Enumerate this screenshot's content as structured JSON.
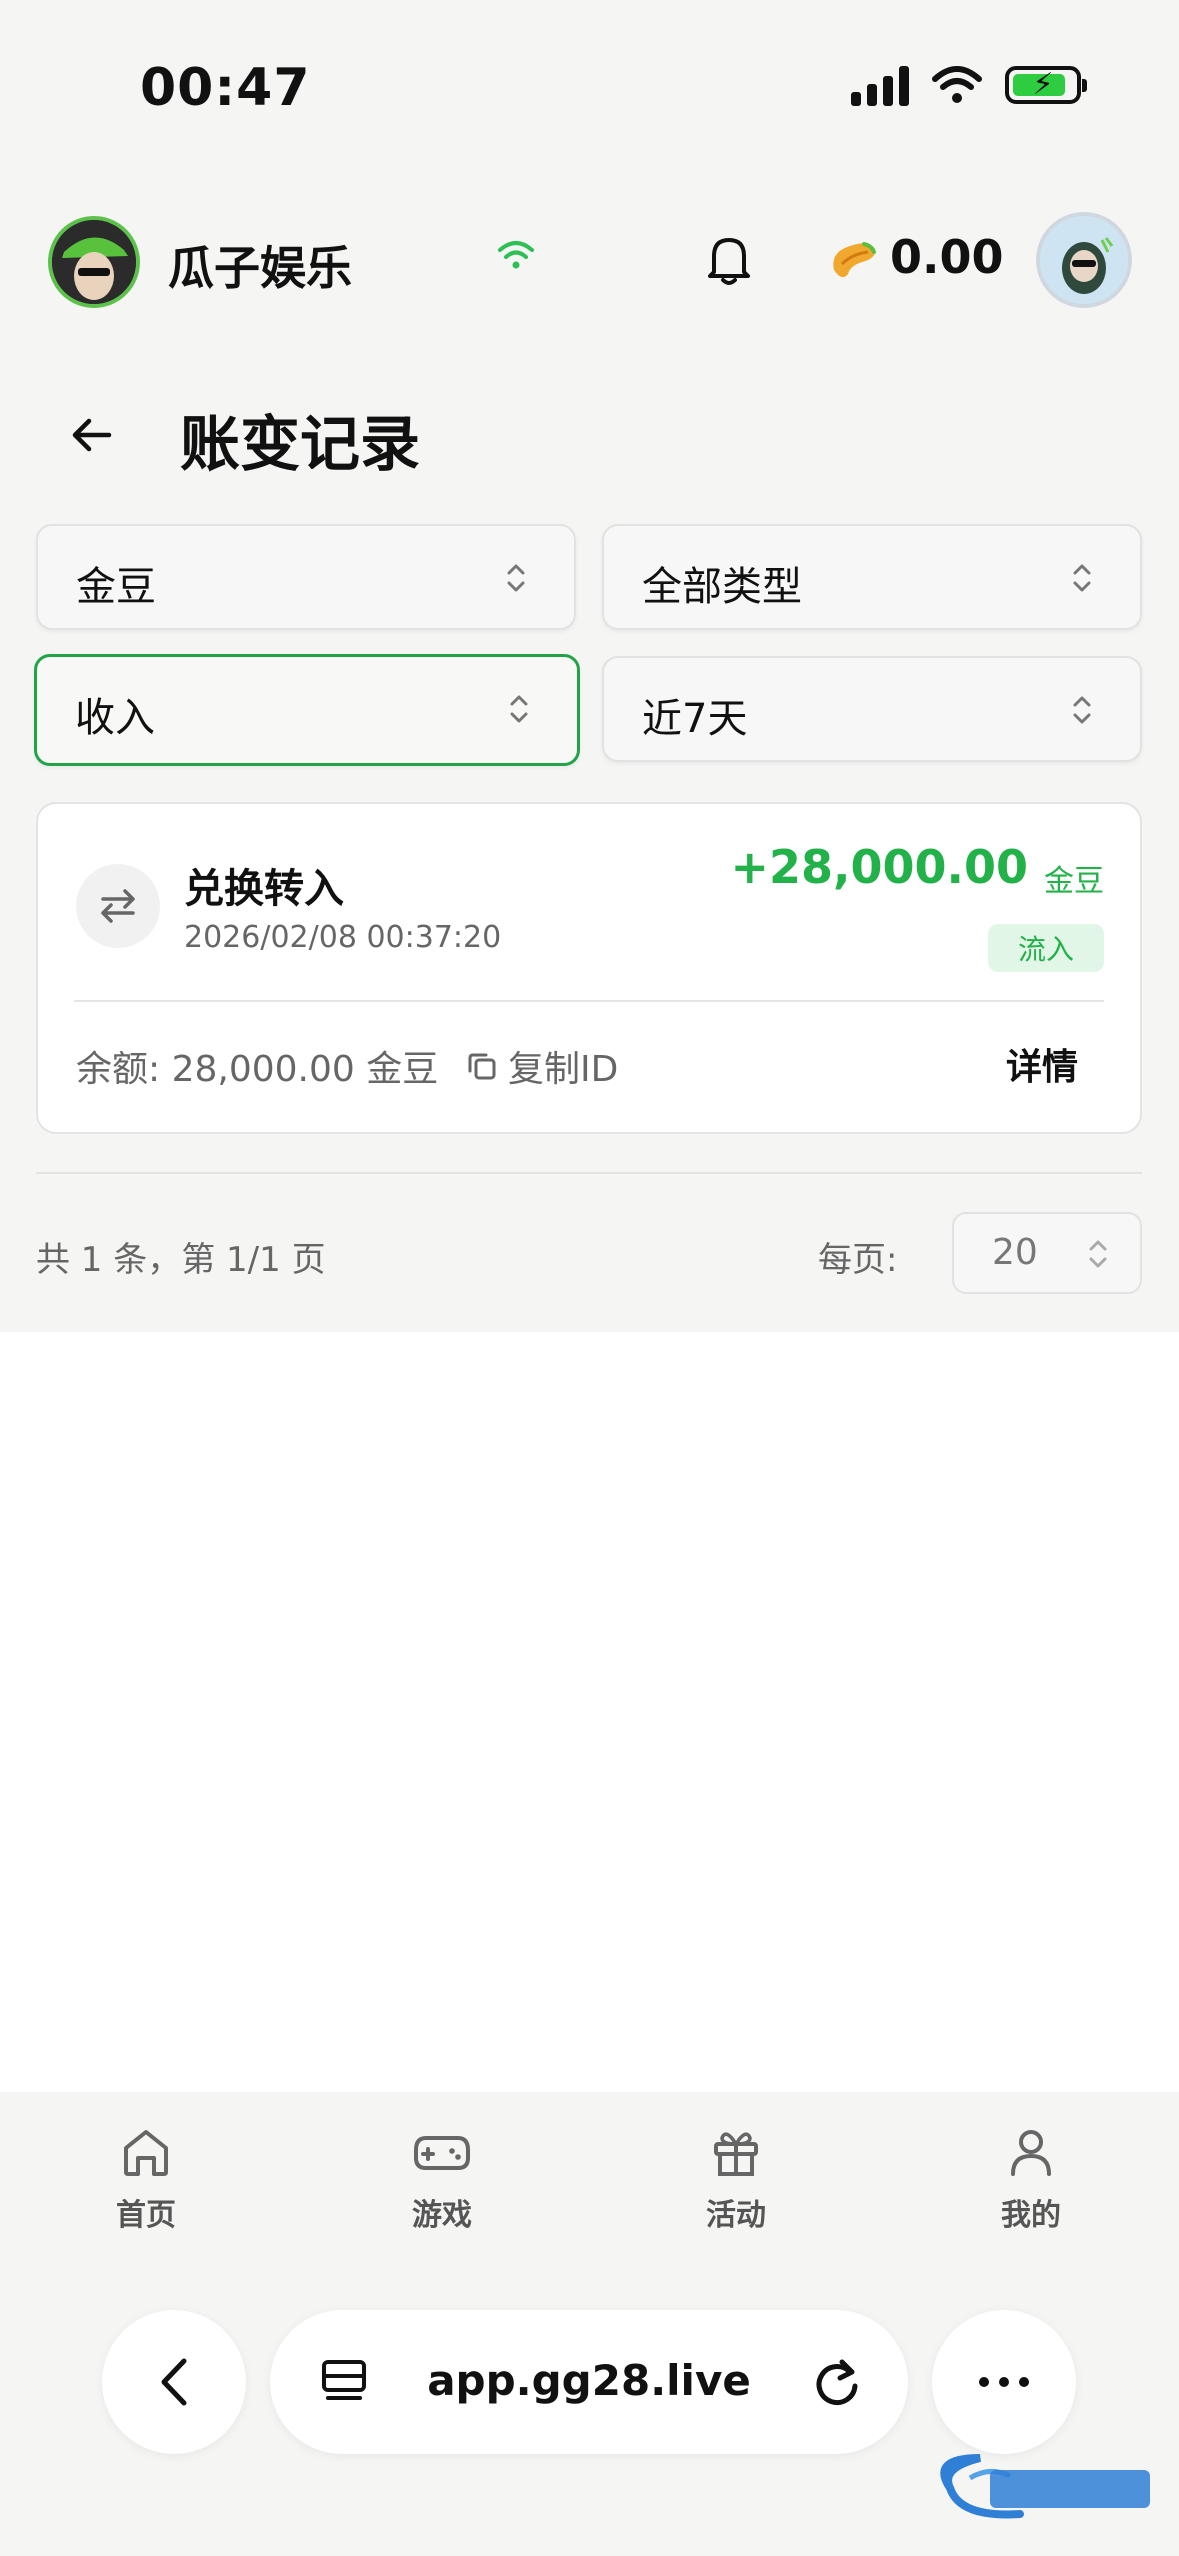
{
  "status_bar": {
    "time": "00:47"
  },
  "header": {
    "app_name": "瓜子娱乐",
    "balance": "0.00"
  },
  "page": {
    "title": "账变记录"
  },
  "filters": {
    "currency": "金豆",
    "type": "全部类型",
    "direction": "收入",
    "range": "近7天"
  },
  "records": [
    {
      "title": "兑换转入",
      "time": "2026/02/08 00:37:20",
      "amount": "+28,000.00",
      "unit": "金豆",
      "flow": "流入",
      "balance": "余额: 28,000.00 金豆",
      "copy_label": "复制ID",
      "detail_label": "详情"
    }
  ],
  "pagination": {
    "summary": "共 1 条，第 1/1 页",
    "per_page_label": "每页:",
    "per_page_value": "20"
  },
  "bottom_nav": [
    {
      "label": "首页",
      "icon": "home-icon"
    },
    {
      "label": "游戏",
      "icon": "gamepad-icon"
    },
    {
      "label": "活动",
      "icon": "gift-icon"
    },
    {
      "label": "我的",
      "icon": "user-icon"
    }
  ],
  "browser": {
    "url": "app.gg28.live"
  },
  "colors": {
    "accent_green": "#23b24a",
    "active_border": "#22a348"
  }
}
